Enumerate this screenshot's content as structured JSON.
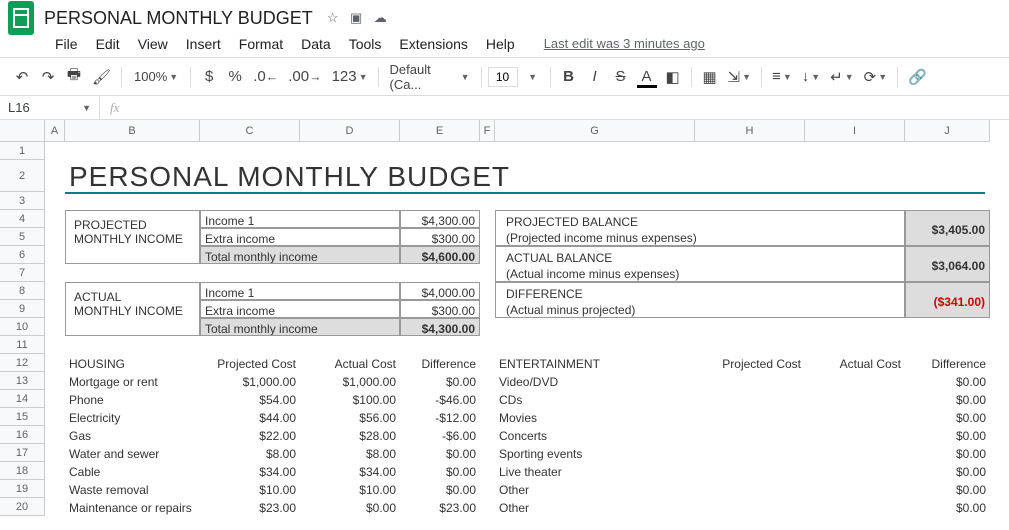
{
  "doc_title": "PERSONAL MONTHLY BUDGET",
  "menus": [
    "File",
    "Edit",
    "View",
    "Insert",
    "Format",
    "Data",
    "Tools",
    "Extensions",
    "Help"
  ],
  "last_edit": "Last edit was 3 minutes ago",
  "zoom": "100%",
  "font_name": "Default (Ca...",
  "font_size": "10",
  "name_box": "L16",
  "col_widths": {
    "A": 20,
    "B": 135,
    "C": 100,
    "D": 100,
    "E": 80,
    "F": 15,
    "G": 200,
    "H": 110,
    "I": 100,
    "J": 85
  },
  "row_heights": {
    "default": 18,
    "1": 18,
    "2": 32
  },
  "sheet_title": "PERSONAL MONTHLY BUDGET",
  "projected_income_label": "PROJECTED MONTHLY INCOME",
  "actual_income_label": "ACTUAL MONTHLY INCOME",
  "income_rows_proj": [
    {
      "label": "Income 1",
      "val": "$4,300.00"
    },
    {
      "label": "Extra income",
      "val": "$300.00"
    },
    {
      "label": "Total monthly income",
      "val": "$4,600.00",
      "shaded": true,
      "bold": true
    }
  ],
  "income_rows_act": [
    {
      "label": "Income 1",
      "val": "$4,000.00"
    },
    {
      "label": "Extra income",
      "val": "$300.00"
    },
    {
      "label": "Total monthly income",
      "val": "$4,300.00",
      "shaded": true,
      "bold": true
    }
  ],
  "balances": [
    {
      "t1": "PROJECTED BALANCE",
      "t2": "(Projected income minus expenses)",
      "val": "$3,405.00"
    },
    {
      "t1": "ACTUAL BALANCE",
      "t2": "(Actual income minus expenses)",
      "val": "$3,064.00"
    },
    {
      "t1": "DIFFERENCE",
      "t2": "(Actual minus projected)",
      "val": "($341.00)",
      "neg": true
    }
  ],
  "housing_header": "HOUSING",
  "entertainment_header": "ENTERTAINMENT",
  "cost_headers": [
    "Projected Cost",
    "Actual Cost",
    "Difference"
  ],
  "housing": [
    {
      "n": "Mortgage or rent",
      "p": "$1,000.00",
      "a": "$1,000.00",
      "d": "$0.00"
    },
    {
      "n": "Phone",
      "p": "$54.00",
      "a": "$100.00",
      "d": "-$46.00"
    },
    {
      "n": "Electricity",
      "p": "$44.00",
      "a": "$56.00",
      "d": "-$12.00"
    },
    {
      "n": "Gas",
      "p": "$22.00",
      "a": "$28.00",
      "d": "-$6.00"
    },
    {
      "n": "Water and sewer",
      "p": "$8.00",
      "a": "$8.00",
      "d": "$0.00"
    },
    {
      "n": "Cable",
      "p": "$34.00",
      "a": "$34.00",
      "d": "$0.00"
    },
    {
      "n": "Waste removal",
      "p": "$10.00",
      "a": "$10.00",
      "d": "$0.00"
    },
    {
      "n": "Maintenance or repairs",
      "p": "$23.00",
      "a": "$0.00",
      "d": "$23.00"
    }
  ],
  "entertainment": [
    {
      "n": "Video/DVD",
      "d": "$0.00"
    },
    {
      "n": "CDs",
      "d": "$0.00"
    },
    {
      "n": "Movies",
      "d": "$0.00"
    },
    {
      "n": "Concerts",
      "d": "$0.00"
    },
    {
      "n": "Sporting events",
      "d": "$0.00"
    },
    {
      "n": "Live theater",
      "d": "$0.00"
    },
    {
      "n": "Other",
      "d": "$0.00"
    },
    {
      "n": "Other",
      "d": "$0.00"
    }
  ]
}
